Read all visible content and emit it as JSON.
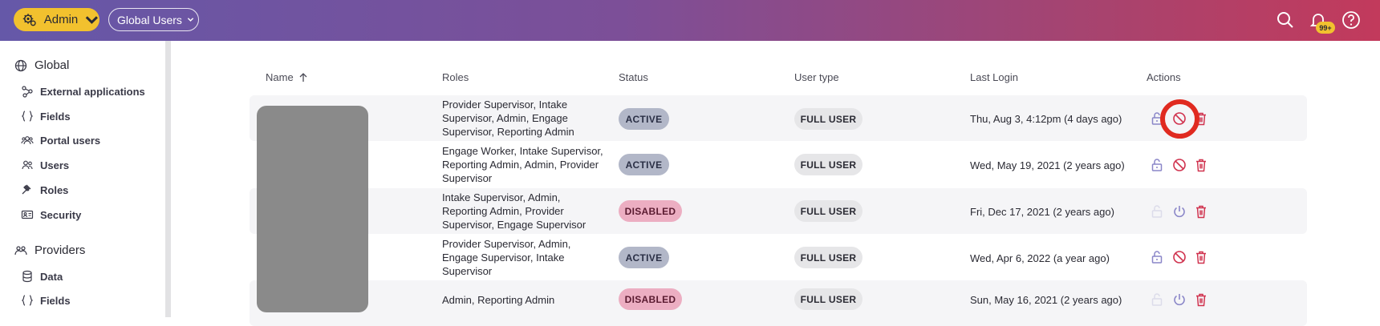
{
  "header": {
    "admin_label": "Admin",
    "scope_label": "Global Users",
    "notification_badge": "99+"
  },
  "sidebar": {
    "global_heading": "Global",
    "global_items": [
      {
        "label": "External applications",
        "icon": "share-nodes-icon"
      },
      {
        "label": "Fields",
        "icon": "braces-icon"
      },
      {
        "label": "Portal users",
        "icon": "users-group-icon"
      },
      {
        "label": "Users",
        "icon": "users-icon"
      },
      {
        "label": "Roles",
        "icon": "gavel-icon"
      },
      {
        "label": "Security",
        "icon": "id-card-icon"
      }
    ],
    "providers_heading": "Providers",
    "providers_items": [
      {
        "label": "Data",
        "icon": "database-icon"
      },
      {
        "label": "Fields",
        "icon": "braces-icon"
      }
    ]
  },
  "table": {
    "columns": [
      "Name",
      "Roles",
      "Status",
      "User type",
      "Last Login",
      "Actions"
    ],
    "sort_indicator": "arrow-up-icon",
    "rows": [
      {
        "roles": [
          "Provider Supervisor, Intake",
          "Supervisor, Admin, Engage",
          "Supervisor, Reporting Admin"
        ],
        "status": "ACTIVE",
        "user_type": "FULL USER",
        "last_login": "Thu, Aug 3, 4:12pm (4 days ago)"
      },
      {
        "roles": [
          "Engage Worker, Intake Supervisor,",
          "Reporting Admin, Admin, Provider",
          "Supervisor"
        ],
        "status": "ACTIVE",
        "user_type": "FULL USER",
        "last_login": "Wed, May 19, 2021 (2 years ago)"
      },
      {
        "roles": [
          "Intake Supervisor, Admin,",
          "Reporting Admin, Provider",
          "Supervisor, Engage Supervisor"
        ],
        "status": "DISABLED",
        "user_type": "FULL USER",
        "last_login": "Fri, Dec 17, 2021 (2 years ago)"
      },
      {
        "roles": [
          "Provider Supervisor, Admin,",
          "Engage Supervisor, Intake",
          "Supervisor"
        ],
        "status": "ACTIVE",
        "user_type": "FULL USER",
        "last_login": "Wed, Apr 6, 2022 (a year ago)"
      },
      {
        "roles": [
          "Admin, Reporting Admin"
        ],
        "status": "DISABLED",
        "user_type": "FULL USER",
        "last_login": "Sun, May 16, 2021 (2 years ago)"
      }
    ]
  },
  "colors": {
    "accent_yellow": "#f2c12e",
    "delete_red": "#d0324e",
    "highlight_red": "#e02a20"
  }
}
